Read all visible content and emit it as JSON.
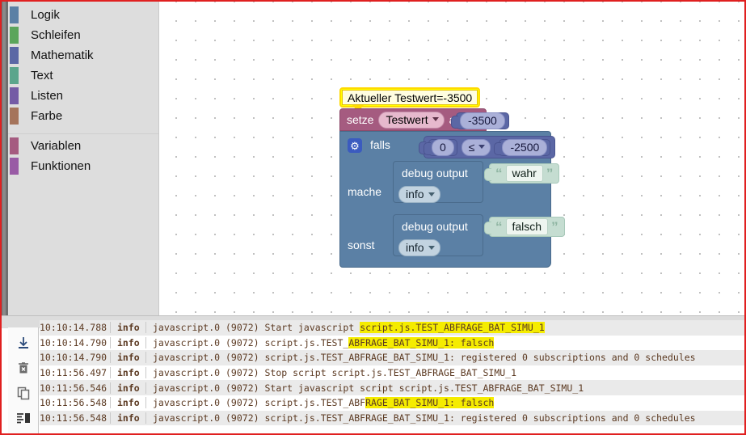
{
  "toolbox": {
    "categories": [
      {
        "label": "Logik",
        "color": "#5b80a5"
      },
      {
        "label": "Schleifen",
        "color": "#5ba55b"
      },
      {
        "label": "Mathematik",
        "color": "#5b67a5"
      },
      {
        "label": "Text",
        "color": "#5ba58c"
      },
      {
        "label": "Listen",
        "color": "#745ba5"
      },
      {
        "label": "Farbe",
        "color": "#a5745b"
      }
    ],
    "categories2": [
      {
        "label": "Variablen",
        "color": "#a55b80"
      },
      {
        "label": "Funktionen",
        "color": "#995ba5"
      }
    ]
  },
  "workspace": {
    "comment": {
      "text": "Aktueller Testwert=-3500",
      "color": "#ffff00"
    },
    "set_block": {
      "keyword": "setze",
      "variable": "Testwert",
      "keyword2": "auf",
      "value": "-3500",
      "color": "#a55b80"
    },
    "if_block": {
      "gear_icon": "gear-icon",
      "if_label": "falls",
      "do_label": "mache",
      "else_label": "sonst",
      "color": "#5b80a5",
      "condition": {
        "left": "0",
        "operator": "≤",
        "right": "-2500",
        "color": "#5b67a5"
      }
    },
    "do_statement": {
      "label": "debug output",
      "severity": "info",
      "text": "wahr",
      "text_color": "#c5ddd1"
    },
    "else_statement": {
      "label": "debug output",
      "severity": "info",
      "text": "falsch",
      "text_color": "#c5ddd1"
    }
  },
  "log": {
    "tools": [
      {
        "name": "download-icon"
      },
      {
        "name": "trash-delete-icon"
      },
      {
        "name": "copy-icon"
      },
      {
        "name": "list-view-icon"
      }
    ],
    "rows": [
      {
        "time": "10:10:14.788",
        "severity": "info",
        "pre": "javascript.0 (9072) Start javascript ",
        "hl": "script.js.TEST_ABFRAGE_BAT_SIMU_1",
        "post": ""
      },
      {
        "time": "10:10:14.790",
        "severity": "info",
        "pre": "javascript.0 (9072) script.js.TEST_",
        "hl": "ABFRAGE_BAT_SIMU_1: falsch",
        "post": ""
      },
      {
        "time": "10:10:14.790",
        "severity": "info",
        "pre": "javascript.0 (9072) script.js.TEST_ABFRAGE_BAT_SIMU_1: registered 0 subscriptions and 0 schedules",
        "hl": "",
        "post": ""
      },
      {
        "time": "10:11:56.497",
        "severity": "info",
        "pre": "javascript.0 (9072) Stop script script.js.TEST_ABFRAGE_BAT_SIMU_1",
        "hl": "",
        "post": ""
      },
      {
        "time": "10:11:56.546",
        "severity": "info",
        "pre": "javascript.0 (9072) Start javascript script script.js.TEST_ABFRAGE_BAT_SIMU_1",
        "hl": "",
        "post": ""
      },
      {
        "time": "10:11:56.548",
        "severity": "info",
        "pre": "javascript.0 (9072) script.js.TEST_ABF",
        "hl": "RAGE_BAT_SIMU_1: falsch",
        "post": ""
      },
      {
        "time": "10:11:56.548",
        "severity": "info",
        "pre": "javascript.0 (9072) script.js.TEST_ABFRAGE_BAT_SIMU_1: registered 0 subscriptions and 0 schedules",
        "hl": "",
        "post": ""
      }
    ]
  }
}
